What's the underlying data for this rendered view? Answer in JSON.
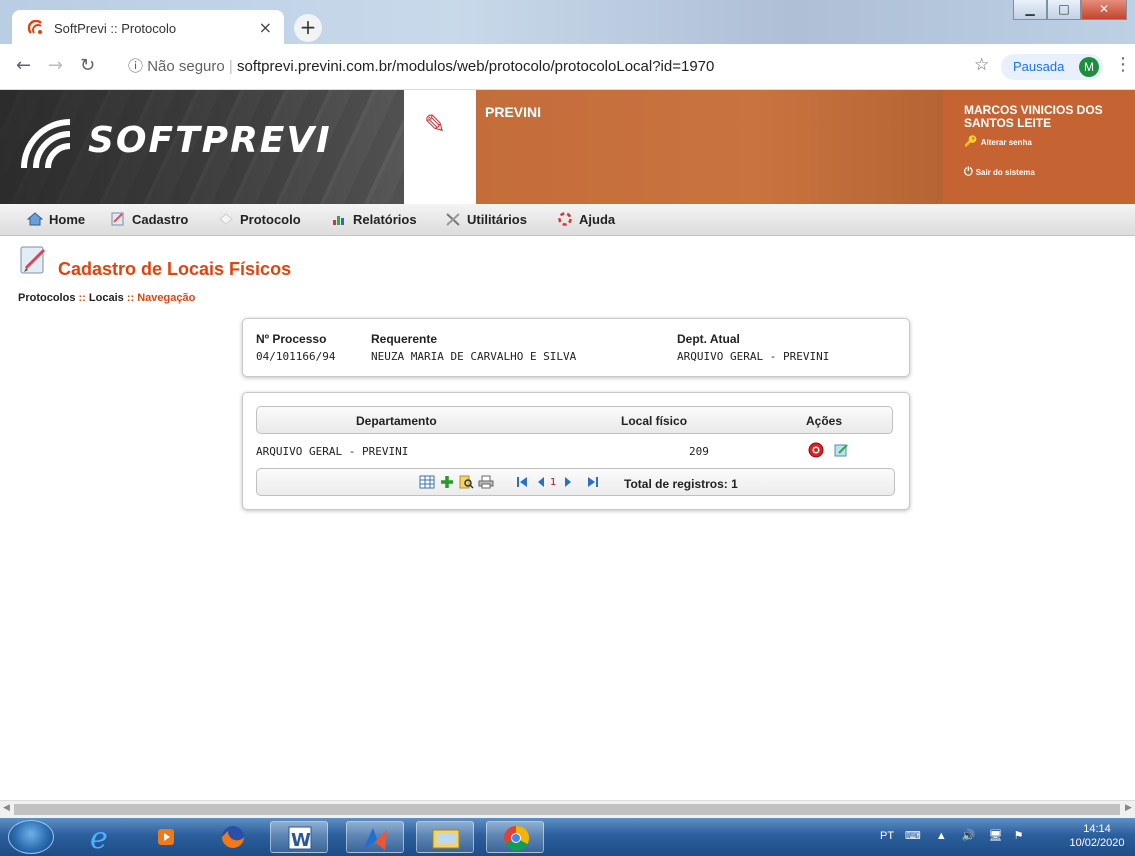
{
  "browser": {
    "tab_title": "SoftPrevi :: Protocolo",
    "tab_close": "×",
    "new_tab": "+",
    "address": {
      "security": "Não seguro",
      "url": "softprevi.previni.com.br/modulos/web/protocolo/protocoloLocal?id=1970"
    },
    "profile": {
      "label": "Pausada",
      "initial": "M"
    }
  },
  "header": {
    "logo_text": "SOFTPREVI",
    "organization": "PREVINI",
    "user": {
      "name": "MARCOS VINICIOS DOS SANTOS LEITE",
      "change_password": "Alterar senha",
      "logout": "Sair do sistema"
    }
  },
  "menu": {
    "items": [
      {
        "label": "Home",
        "icon": "home-icon"
      },
      {
        "label": "Cadastro",
        "icon": "cadastro-icon"
      },
      {
        "label": "Protocolo",
        "icon": "protocolo-icon"
      },
      {
        "label": "Relatórios",
        "icon": "chart-icon"
      },
      {
        "label": "Utilitários",
        "icon": "tools-icon"
      },
      {
        "label": "Ajuda",
        "icon": "lifebuoy-icon"
      }
    ]
  },
  "page": {
    "title": "Cadastro de Locais Físicos",
    "breadcrumb": {
      "items": [
        "Protocolos",
        "Locais",
        "Navegação"
      ],
      "separator": " :: "
    }
  },
  "process": {
    "labels": {
      "number": "Nº Processo",
      "requester": "Requerente",
      "dept": "Dept. Atual"
    },
    "number": "04/101166/94",
    "requester": "NEUZA MARIA DE CARVALHO E SILVA",
    "dept": "ARQUIVO GERAL - PREVINI"
  },
  "table": {
    "columns": [
      "Departamento",
      "Local físico",
      "Ações"
    ],
    "rows": [
      {
        "departamento": "ARQUIVO GERAL - PREVINI",
        "local": "209"
      }
    ],
    "pager": {
      "page": "1",
      "total": "Total de registros: 1"
    }
  },
  "taskbar": {
    "language": "PT",
    "time": "14:14",
    "date": "10/02/2020"
  },
  "colors": {
    "accent": "#e0440e",
    "header_orange": "#c56332"
  }
}
